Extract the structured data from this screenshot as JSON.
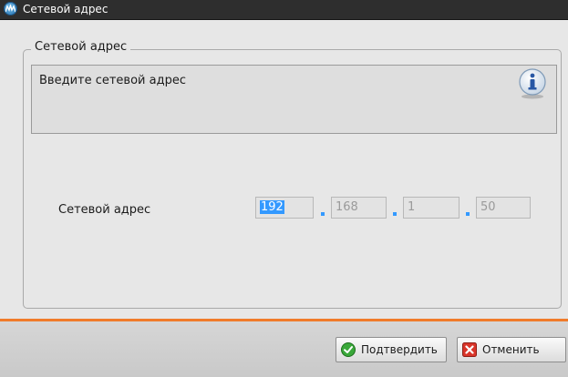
{
  "window": {
    "title": "Сетевой адрес"
  },
  "group": {
    "legend": "Сетевой адрес"
  },
  "info": {
    "text": "Введите сетевой адрес"
  },
  "field": {
    "label": "Сетевой адрес",
    "octets": [
      "192",
      "168",
      "1",
      "50"
    ]
  },
  "buttons": {
    "confirm": "Подтвердить",
    "cancel": "Отменить"
  },
  "colors": {
    "accent": "#f07b2a",
    "selection": "#3399ff"
  }
}
